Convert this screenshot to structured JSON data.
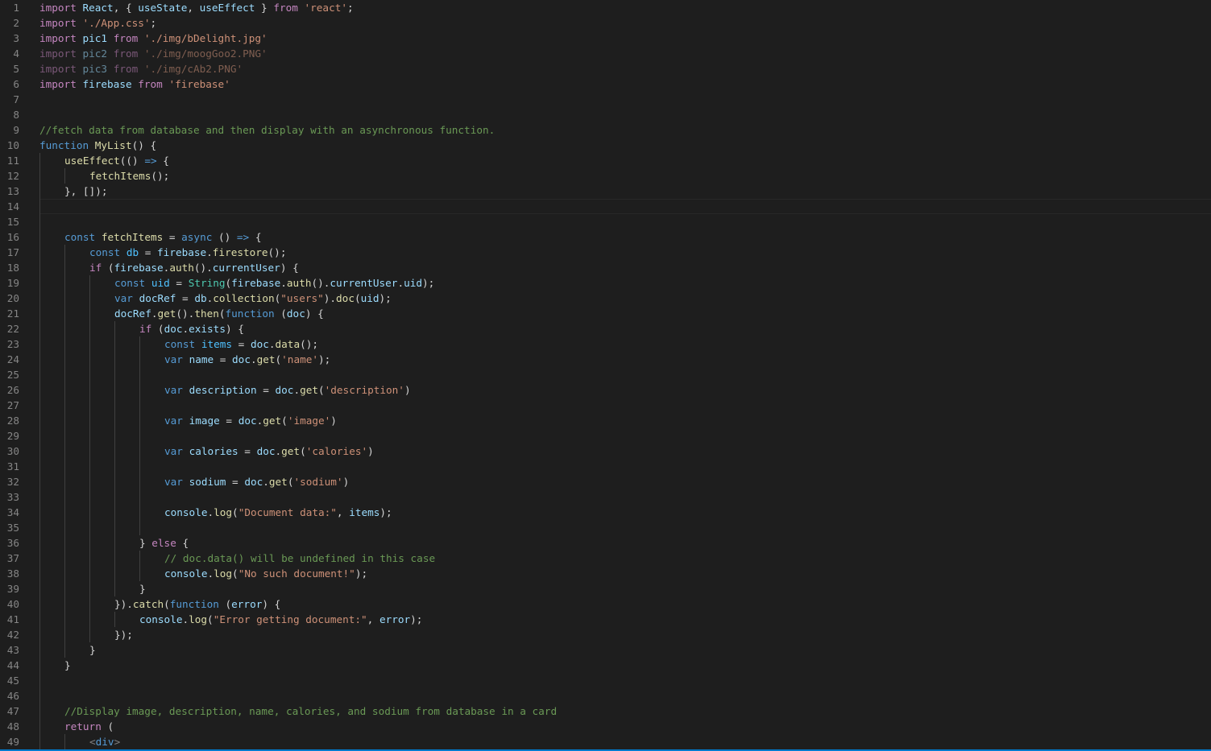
{
  "editor": {
    "colors": {
      "background": "#1e1e1e",
      "keyword": "#569cd6",
      "control": "#c586c0",
      "string": "#ce9178",
      "function": "#dcdcaa",
      "variable": "#9cdcfe",
      "constant": "#4fc1ff",
      "type": "#4ec9b0",
      "comment": "#6a9955",
      "plain": "#d4d4d4",
      "line_number": "#858585"
    },
    "current_line": 14,
    "lines": [
      {
        "n": "1",
        "indent": 0,
        "tokens": [
          [
            "ctl",
            "import"
          ],
          [
            "pl",
            " "
          ],
          [
            "var",
            "React"
          ],
          [
            "pl",
            ", { "
          ],
          [
            "var",
            "useState"
          ],
          [
            "pl",
            ", "
          ],
          [
            "var",
            "useEffect"
          ],
          [
            "pl",
            " } "
          ],
          [
            "ctl",
            "from"
          ],
          [
            "pl",
            " "
          ],
          [
            "str",
            "'react'"
          ],
          [
            "pl",
            ";"
          ]
        ]
      },
      {
        "n": "2",
        "indent": 0,
        "tokens": [
          [
            "ctl",
            "import"
          ],
          [
            "pl",
            " "
          ],
          [
            "str",
            "'./App.css'"
          ],
          [
            "pl",
            ";"
          ]
        ]
      },
      {
        "n": "3",
        "indent": 0,
        "tokens": [
          [
            "ctl",
            "import"
          ],
          [
            "pl",
            " "
          ],
          [
            "var",
            "pic1"
          ],
          [
            "pl",
            " "
          ],
          [
            "ctl",
            "from"
          ],
          [
            "pl",
            " "
          ],
          [
            "str",
            "'./img/bDelight.jpg'"
          ]
        ]
      },
      {
        "n": "4",
        "indent": 0,
        "dim": true,
        "tokens": [
          [
            "ctl",
            "import"
          ],
          [
            "pl",
            " "
          ],
          [
            "var",
            "pic2"
          ],
          [
            "pl",
            " "
          ],
          [
            "ctl",
            "from"
          ],
          [
            "pl",
            " "
          ],
          [
            "str",
            "'./img/moogGoo2.PNG'"
          ]
        ]
      },
      {
        "n": "5",
        "indent": 0,
        "dim": true,
        "tokens": [
          [
            "ctl",
            "import"
          ],
          [
            "pl",
            " "
          ],
          [
            "var",
            "pic3"
          ],
          [
            "pl",
            " "
          ],
          [
            "ctl",
            "from"
          ],
          [
            "pl",
            " "
          ],
          [
            "str",
            "'./img/cAb2.PNG'"
          ]
        ]
      },
      {
        "n": "6",
        "indent": 0,
        "tokens": [
          [
            "ctl",
            "import"
          ],
          [
            "pl",
            " "
          ],
          [
            "var",
            "firebase"
          ],
          [
            "pl",
            " "
          ],
          [
            "ctl",
            "from"
          ],
          [
            "pl",
            " "
          ],
          [
            "str",
            "'firebase'"
          ]
        ]
      },
      {
        "n": "7",
        "indent": 0,
        "tokens": []
      },
      {
        "n": "8",
        "indent": 0,
        "tokens": []
      },
      {
        "n": "9",
        "indent": 0,
        "tokens": [
          [
            "cm",
            "//fetch data from database and then display with an asynchronous function."
          ]
        ]
      },
      {
        "n": "10",
        "indent": 0,
        "tokens": [
          [
            "kw",
            "function"
          ],
          [
            "pl",
            " "
          ],
          [
            "fn",
            "MyList"
          ],
          [
            "pl",
            "() {"
          ]
        ]
      },
      {
        "n": "11",
        "indent": 1,
        "tokens": [
          [
            "fn",
            "useEffect"
          ],
          [
            "pl",
            "(() "
          ],
          [
            "kw",
            "=>"
          ],
          [
            "pl",
            " {"
          ]
        ]
      },
      {
        "n": "12",
        "indent": 2,
        "tokens": [
          [
            "fn",
            "fetchItems"
          ],
          [
            "pl",
            "();"
          ]
        ]
      },
      {
        "n": "13",
        "indent": 1,
        "tokens": [
          [
            "pl",
            "}, []);"
          ]
        ]
      },
      {
        "n": "14",
        "indent": 0,
        "guides": 1,
        "tokens": []
      },
      {
        "n": "15",
        "indent": 0,
        "guides": 1,
        "tokens": []
      },
      {
        "n": "16",
        "indent": 1,
        "tokens": [
          [
            "kw",
            "const"
          ],
          [
            "pl",
            " "
          ],
          [
            "fn",
            "fetchItems"
          ],
          [
            "pl",
            " = "
          ],
          [
            "kw",
            "async"
          ],
          [
            "pl",
            " () "
          ],
          [
            "kw",
            "=>"
          ],
          [
            "pl",
            " {"
          ]
        ]
      },
      {
        "n": "17",
        "indent": 2,
        "tokens": [
          [
            "kw",
            "const"
          ],
          [
            "pl",
            " "
          ],
          [
            "const",
            "db"
          ],
          [
            "pl",
            " = "
          ],
          [
            "var",
            "firebase"
          ],
          [
            "pl",
            "."
          ],
          [
            "fn",
            "firestore"
          ],
          [
            "pl",
            "();"
          ]
        ]
      },
      {
        "n": "18",
        "indent": 2,
        "tokens": [
          [
            "ctl",
            "if"
          ],
          [
            "pl",
            " ("
          ],
          [
            "var",
            "firebase"
          ],
          [
            "pl",
            "."
          ],
          [
            "fn",
            "auth"
          ],
          [
            "pl",
            "()."
          ],
          [
            "var",
            "currentUser"
          ],
          [
            "pl",
            ") {"
          ]
        ]
      },
      {
        "n": "19",
        "indent": 3,
        "tokens": [
          [
            "kw",
            "const"
          ],
          [
            "pl",
            " "
          ],
          [
            "const",
            "uid"
          ],
          [
            "pl",
            " = "
          ],
          [
            "typ",
            "String"
          ],
          [
            "pl",
            "("
          ],
          [
            "var",
            "firebase"
          ],
          [
            "pl",
            "."
          ],
          [
            "fn",
            "auth"
          ],
          [
            "pl",
            "()."
          ],
          [
            "var",
            "currentUser"
          ],
          [
            "pl",
            "."
          ],
          [
            "var",
            "uid"
          ],
          [
            "pl",
            ");"
          ]
        ]
      },
      {
        "n": "20",
        "indent": 3,
        "tokens": [
          [
            "kw",
            "var"
          ],
          [
            "pl",
            " "
          ],
          [
            "var",
            "docRef"
          ],
          [
            "pl",
            " = "
          ],
          [
            "var",
            "db"
          ],
          [
            "pl",
            "."
          ],
          [
            "fn",
            "collection"
          ],
          [
            "pl",
            "("
          ],
          [
            "str",
            "\"users\""
          ],
          [
            "pl",
            ")."
          ],
          [
            "fn",
            "doc"
          ],
          [
            "pl",
            "("
          ],
          [
            "var",
            "uid"
          ],
          [
            "pl",
            ");"
          ]
        ]
      },
      {
        "n": "21",
        "indent": 3,
        "tokens": [
          [
            "var",
            "docRef"
          ],
          [
            "pl",
            "."
          ],
          [
            "fn",
            "get"
          ],
          [
            "pl",
            "()."
          ],
          [
            "fn",
            "then"
          ],
          [
            "pl",
            "("
          ],
          [
            "kw",
            "function"
          ],
          [
            "pl",
            " ("
          ],
          [
            "var",
            "doc"
          ],
          [
            "pl",
            ") {"
          ]
        ]
      },
      {
        "n": "22",
        "indent": 4,
        "tokens": [
          [
            "ctl",
            "if"
          ],
          [
            "pl",
            " ("
          ],
          [
            "var",
            "doc"
          ],
          [
            "pl",
            "."
          ],
          [
            "var",
            "exists"
          ],
          [
            "pl",
            ") {"
          ]
        ]
      },
      {
        "n": "23",
        "indent": 5,
        "tokens": [
          [
            "kw",
            "const"
          ],
          [
            "pl",
            " "
          ],
          [
            "const",
            "items"
          ],
          [
            "pl",
            " = "
          ],
          [
            "var",
            "doc"
          ],
          [
            "pl",
            "."
          ],
          [
            "fn",
            "data"
          ],
          [
            "pl",
            "();"
          ]
        ]
      },
      {
        "n": "24",
        "indent": 5,
        "tokens": [
          [
            "kw",
            "var"
          ],
          [
            "pl",
            " "
          ],
          [
            "var",
            "name"
          ],
          [
            "pl",
            " = "
          ],
          [
            "var",
            "doc"
          ],
          [
            "pl",
            "."
          ],
          [
            "fn",
            "get"
          ],
          [
            "pl",
            "("
          ],
          [
            "str",
            "'name'"
          ],
          [
            "pl",
            ");"
          ]
        ]
      },
      {
        "n": "25",
        "indent": 0,
        "guides": 5,
        "tokens": []
      },
      {
        "n": "26",
        "indent": 5,
        "tokens": [
          [
            "kw",
            "var"
          ],
          [
            "pl",
            " "
          ],
          [
            "var",
            "description"
          ],
          [
            "pl",
            " = "
          ],
          [
            "var",
            "doc"
          ],
          [
            "pl",
            "."
          ],
          [
            "fn",
            "get"
          ],
          [
            "pl",
            "("
          ],
          [
            "str",
            "'description'"
          ],
          [
            "pl",
            ")"
          ]
        ]
      },
      {
        "n": "27",
        "indent": 0,
        "guides": 5,
        "tokens": []
      },
      {
        "n": "28",
        "indent": 5,
        "tokens": [
          [
            "kw",
            "var"
          ],
          [
            "pl",
            " "
          ],
          [
            "var",
            "image"
          ],
          [
            "pl",
            " = "
          ],
          [
            "var",
            "doc"
          ],
          [
            "pl",
            "."
          ],
          [
            "fn",
            "get"
          ],
          [
            "pl",
            "("
          ],
          [
            "str",
            "'image'"
          ],
          [
            "pl",
            ")"
          ]
        ]
      },
      {
        "n": "29",
        "indent": 0,
        "guides": 5,
        "tokens": []
      },
      {
        "n": "30",
        "indent": 5,
        "tokens": [
          [
            "kw",
            "var"
          ],
          [
            "pl",
            " "
          ],
          [
            "var",
            "calories"
          ],
          [
            "pl",
            " = "
          ],
          [
            "var",
            "doc"
          ],
          [
            "pl",
            "."
          ],
          [
            "fn",
            "get"
          ],
          [
            "pl",
            "("
          ],
          [
            "str",
            "'calories'"
          ],
          [
            "pl",
            ")"
          ]
        ]
      },
      {
        "n": "31",
        "indent": 0,
        "guides": 5,
        "tokens": []
      },
      {
        "n": "32",
        "indent": 5,
        "tokens": [
          [
            "kw",
            "var"
          ],
          [
            "pl",
            " "
          ],
          [
            "var",
            "sodium"
          ],
          [
            "pl",
            " = "
          ],
          [
            "var",
            "doc"
          ],
          [
            "pl",
            "."
          ],
          [
            "fn",
            "get"
          ],
          [
            "pl",
            "("
          ],
          [
            "str",
            "'sodium'"
          ],
          [
            "pl",
            ")"
          ]
        ]
      },
      {
        "n": "33",
        "indent": 0,
        "guides": 5,
        "tokens": []
      },
      {
        "n": "34",
        "indent": 5,
        "tokens": [
          [
            "var",
            "console"
          ],
          [
            "pl",
            "."
          ],
          [
            "fn",
            "log"
          ],
          [
            "pl",
            "("
          ],
          [
            "str",
            "\"Document data:\""
          ],
          [
            "pl",
            ", "
          ],
          [
            "var",
            "items"
          ],
          [
            "pl",
            ");"
          ]
        ]
      },
      {
        "n": "35",
        "indent": 0,
        "guides": 5,
        "tokens": []
      },
      {
        "n": "36",
        "indent": 4,
        "tokens": [
          [
            "pl",
            "} "
          ],
          [
            "ctl",
            "else"
          ],
          [
            "pl",
            " {"
          ]
        ]
      },
      {
        "n": "37",
        "indent": 5,
        "tokens": [
          [
            "cm",
            "// doc.data() will be undefined in this case"
          ]
        ]
      },
      {
        "n": "38",
        "indent": 5,
        "tokens": [
          [
            "var",
            "console"
          ],
          [
            "pl",
            "."
          ],
          [
            "fn",
            "log"
          ],
          [
            "pl",
            "("
          ],
          [
            "str",
            "\"No such document!\""
          ],
          [
            "pl",
            ");"
          ]
        ]
      },
      {
        "n": "39",
        "indent": 4,
        "tokens": [
          [
            "pl",
            "}"
          ]
        ]
      },
      {
        "n": "40",
        "indent": 3,
        "tokens": [
          [
            "pl",
            "})."
          ],
          [
            "fn",
            "catch"
          ],
          [
            "pl",
            "("
          ],
          [
            "kw",
            "function"
          ],
          [
            "pl",
            " ("
          ],
          [
            "var",
            "error"
          ],
          [
            "pl",
            ") {"
          ]
        ]
      },
      {
        "n": "41",
        "indent": 4,
        "tokens": [
          [
            "var",
            "console"
          ],
          [
            "pl",
            "."
          ],
          [
            "fn",
            "log"
          ],
          [
            "pl",
            "("
          ],
          [
            "str",
            "\"Error getting document:\""
          ],
          [
            "pl",
            ", "
          ],
          [
            "var",
            "error"
          ],
          [
            "pl",
            ");"
          ]
        ]
      },
      {
        "n": "42",
        "indent": 3,
        "tokens": [
          [
            "pl",
            "});"
          ]
        ]
      },
      {
        "n": "43",
        "indent": 2,
        "tokens": [
          [
            "pl",
            "}"
          ]
        ]
      },
      {
        "n": "44",
        "indent": 1,
        "tokens": [
          [
            "pl",
            "}"
          ]
        ]
      },
      {
        "n": "45",
        "indent": 0,
        "guides": 1,
        "tokens": []
      },
      {
        "n": "46",
        "indent": 0,
        "guides": 1,
        "tokens": []
      },
      {
        "n": "47",
        "indent": 1,
        "tokens": [
          [
            "cm",
            "//Display image, description, name, calories, and sodium from database in a card"
          ]
        ]
      },
      {
        "n": "48",
        "indent": 1,
        "tokens": [
          [
            "ctl",
            "return"
          ],
          [
            "pl",
            " ("
          ]
        ]
      },
      {
        "n": "49",
        "indent": 2,
        "tokens": [
          [
            "tag",
            "<"
          ],
          [
            "tagname",
            "div"
          ],
          [
            "tag",
            ">"
          ]
        ]
      }
    ]
  }
}
